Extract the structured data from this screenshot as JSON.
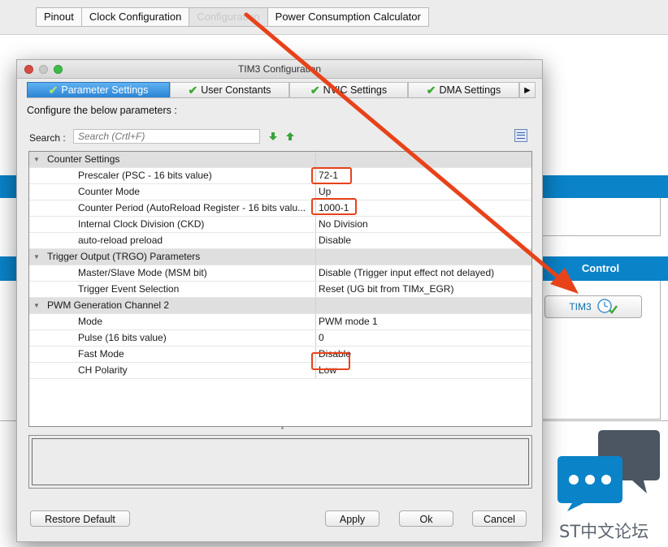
{
  "top_tabs": [
    {
      "label": "Pinout",
      "active": false
    },
    {
      "label": "Clock Configuration",
      "active": false
    },
    {
      "label": "Configuration",
      "active": true
    },
    {
      "label": "Power Consumption Calculator",
      "active": false
    }
  ],
  "background": {
    "control_label": "Control",
    "tim3_button_label": "TIM3",
    "tim3_icon": "clock-check-icon"
  },
  "dialog": {
    "title": "TIM3 Configuration",
    "tabs": [
      {
        "label": "Parameter Settings",
        "active": true,
        "icon": "check-icon"
      },
      {
        "label": "User Constants",
        "active": false,
        "icon": "check-icon"
      },
      {
        "label": "NVIC Settings",
        "active": false,
        "icon": "check-icon"
      },
      {
        "label": "DMA Settings",
        "active": false,
        "icon": "check-icon"
      }
    ],
    "configure_label": "Configure the below parameters :",
    "search": {
      "label": "Search :",
      "placeholder": "Search (Crtl+F)"
    },
    "rows": [
      {
        "type": "group",
        "name": "Counter Settings",
        "value": ""
      },
      {
        "type": "param",
        "name": "Prescaler (PSC - 16 bits value)",
        "value": "72-1",
        "highlight": true
      },
      {
        "type": "param",
        "name": "Counter Mode",
        "value": "Up"
      },
      {
        "type": "param",
        "name": "Counter Period (AutoReload Register - 16 bits valu...",
        "value": "1000-1",
        "highlight": true
      },
      {
        "type": "param",
        "name": "Internal Clock Division (CKD)",
        "value": "No Division"
      },
      {
        "type": "param",
        "name": "auto-reload preload",
        "value": "Disable"
      },
      {
        "type": "group",
        "name": "Trigger Output (TRGO) Parameters",
        "value": ""
      },
      {
        "type": "param",
        "name": "Master/Slave Mode (MSM bit)",
        "value": "Disable (Trigger input effect not delayed)"
      },
      {
        "type": "param",
        "name": "Trigger Event Selection",
        "value": "Reset (UG bit from TIMx_EGR)"
      },
      {
        "type": "group",
        "name": "PWM Generation Channel 2",
        "value": ""
      },
      {
        "type": "param",
        "name": "Mode",
        "value": "PWM mode 1"
      },
      {
        "type": "param",
        "name": "Pulse (16 bits value)",
        "value": "0"
      },
      {
        "type": "param",
        "name": "Fast Mode",
        "value": "Disable"
      },
      {
        "type": "param",
        "name": "CH Polarity",
        "value": "Low",
        "highlight": true
      }
    ],
    "buttons": {
      "restore": "Restore Default",
      "apply": "Apply",
      "ok": "Ok",
      "cancel": "Cancel"
    }
  },
  "annotation": {
    "color": "#e8421a"
  },
  "watermark": {
    "text": "ST中文论坛"
  },
  "colors": {
    "accent_blue": "#0a83c8",
    "active_tab": "#2b84d4",
    "check_green": "#3ea935"
  }
}
